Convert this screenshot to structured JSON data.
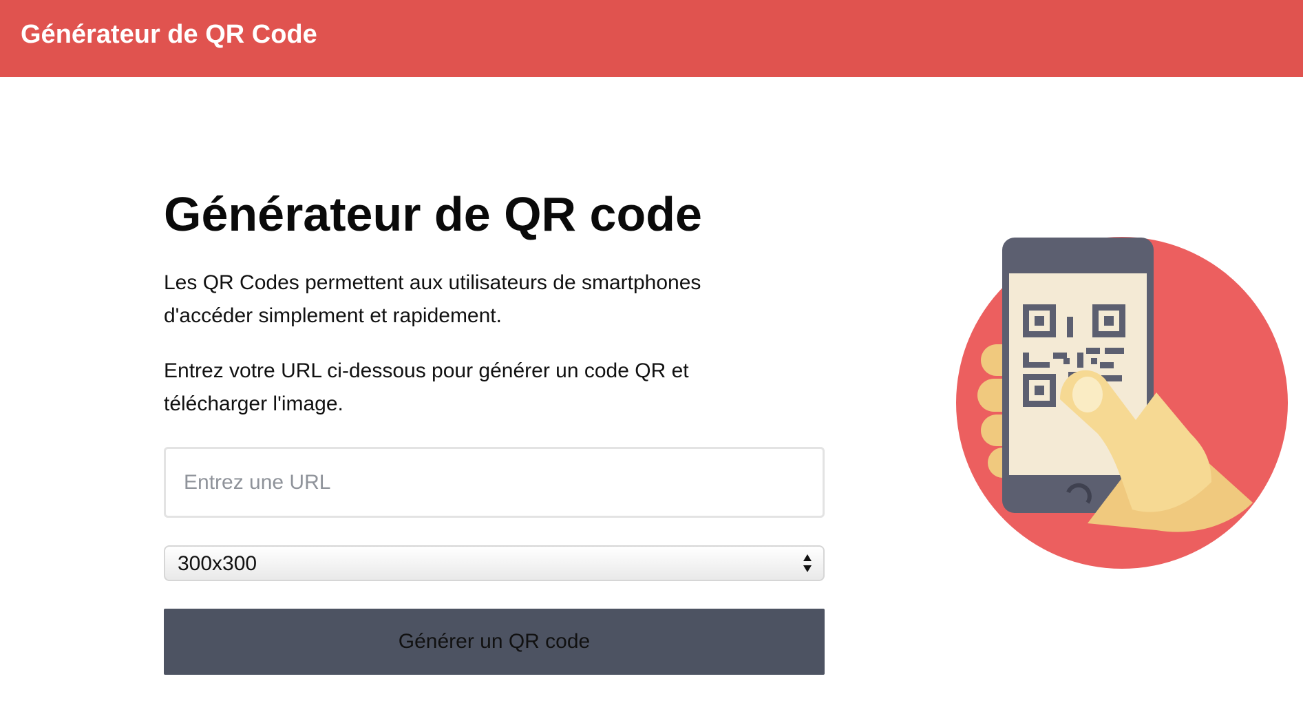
{
  "header": {
    "brand": "Générateur de QR Code"
  },
  "main": {
    "title": "Générateur de QR code",
    "intro": "Les QR Codes permettent aux utilisateurs de smartphones d'accéder simplement et rapidement.",
    "instruction": "Entrez votre URL ci-dessous pour générer un code QR et télécharger l'image.",
    "url_input": {
      "value": "",
      "placeholder": "Entrez une URL"
    },
    "size_select": {
      "selected": "300x300"
    },
    "generate_button": "Générer un QR code"
  },
  "illustration": {
    "icon": "phone-scanning-qr-illustration"
  },
  "colors": {
    "header": "#e0534f",
    "circle": "#ec5f5f",
    "button": "#4d5362",
    "phone": "#5c5f70",
    "screen": "#f4ead5",
    "hand": "#f6d993"
  }
}
